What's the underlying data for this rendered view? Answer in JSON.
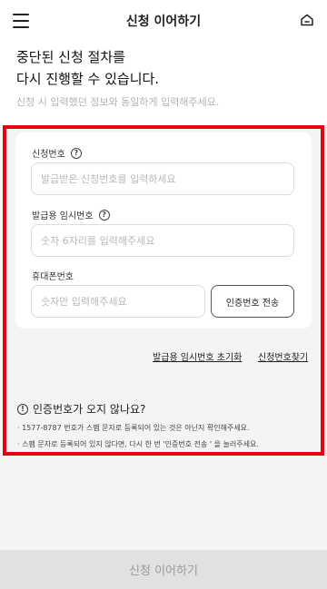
{
  "header": {
    "title": "신청 이어하기",
    "menu_icon": "hamburger-menu-icon",
    "home_icon": "home-icon"
  },
  "intro": {
    "line1": "중단된 신청 절차를",
    "line2": "다시 진행할 수 있습니다.",
    "sub": "신청 시 입력했던 정보와 동일하게 입력해주세요."
  },
  "form": {
    "application_number": {
      "label": "신청번호",
      "value": "",
      "placeholder": "발급받은 신청번호를 입력하세요"
    },
    "temp_password": {
      "label": "발급용 임시번호",
      "value": "",
      "placeholder": "숫자 6자리를 입력해주세요"
    },
    "phone": {
      "label": "휴대폰번호",
      "value": "",
      "placeholder": "숫자만 입력해주세요"
    },
    "send_code_label": "인증번호 전송"
  },
  "links": {
    "reset_temp_password": "발급용 임시번호 초기화",
    "find_application_number": "신청번호찾기"
  },
  "notice": {
    "title": "인증번호가 오지 않나요?",
    "items": [
      "· 1577-8787 번호가 스팸 문자로 등록되어 있는 것은 아닌지 확인해주세요.",
      "· 스팸 문자로 등록되어 있지 않다면, 다시 한 번 '인증번호 전송 ' 을 눌러주세요."
    ]
  },
  "footer": {
    "continue_label": "신청 이어하기"
  },
  "colors": {
    "highlight_border": "#e60012",
    "background": "#f4f4f4",
    "disabled_button": "#e1e1e1"
  }
}
